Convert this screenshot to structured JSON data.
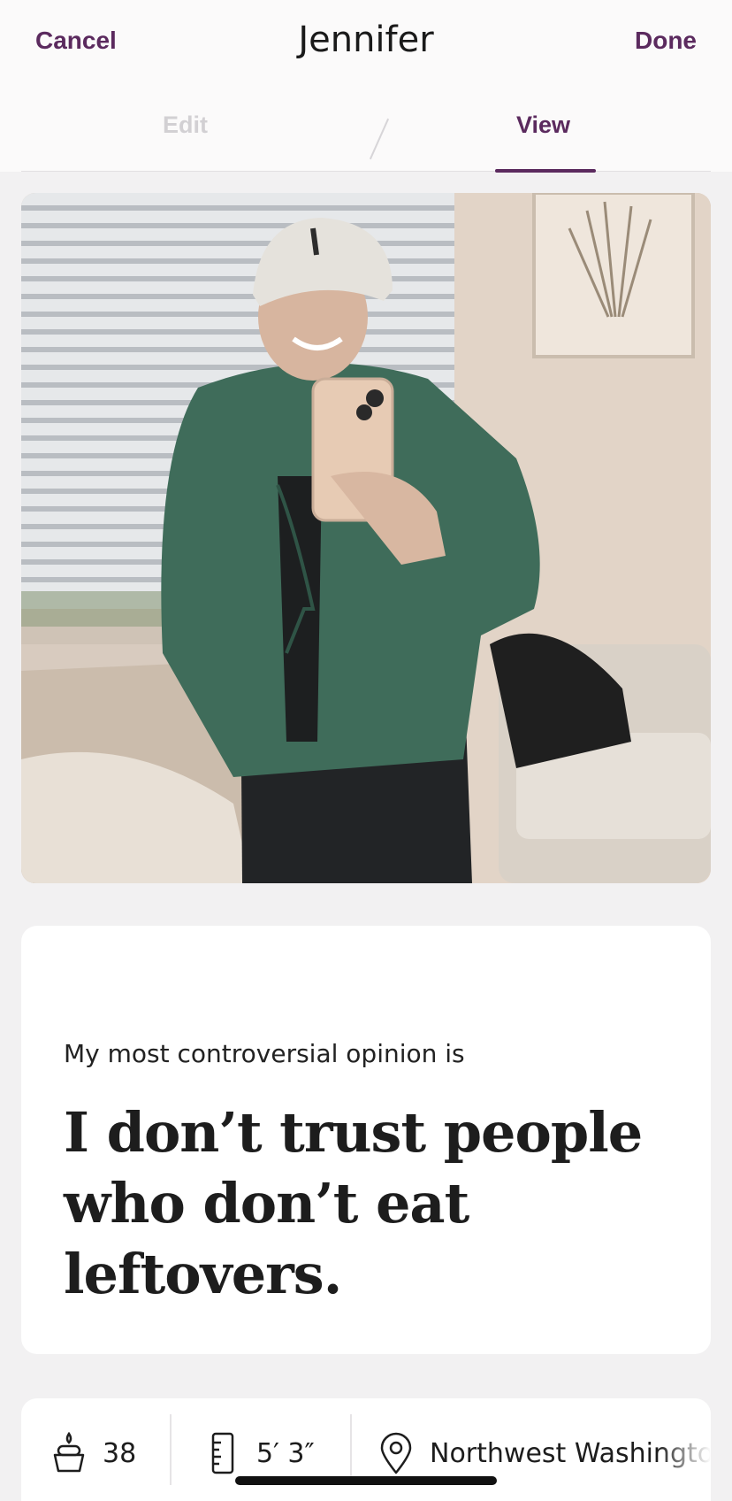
{
  "header": {
    "cancel_label": "Cancel",
    "title": "Jennifer",
    "done_label": "Done"
  },
  "tabs": [
    {
      "label": "Edit",
      "active": false
    },
    {
      "label": "View",
      "active": true
    }
  ],
  "colors": {
    "accent": "#5b2a5e",
    "background": "#f2f1f2",
    "card": "#ffffff"
  },
  "prompt": {
    "question": "My most controversial opinion is",
    "answer": "I don’t trust people who don’t eat leftovers."
  },
  "info": {
    "age": "38",
    "height": "5′ 3″",
    "location": "Northwest Washington"
  },
  "icons": {
    "age": "cake-icon",
    "height": "ruler-icon",
    "location": "location-pin-icon"
  }
}
